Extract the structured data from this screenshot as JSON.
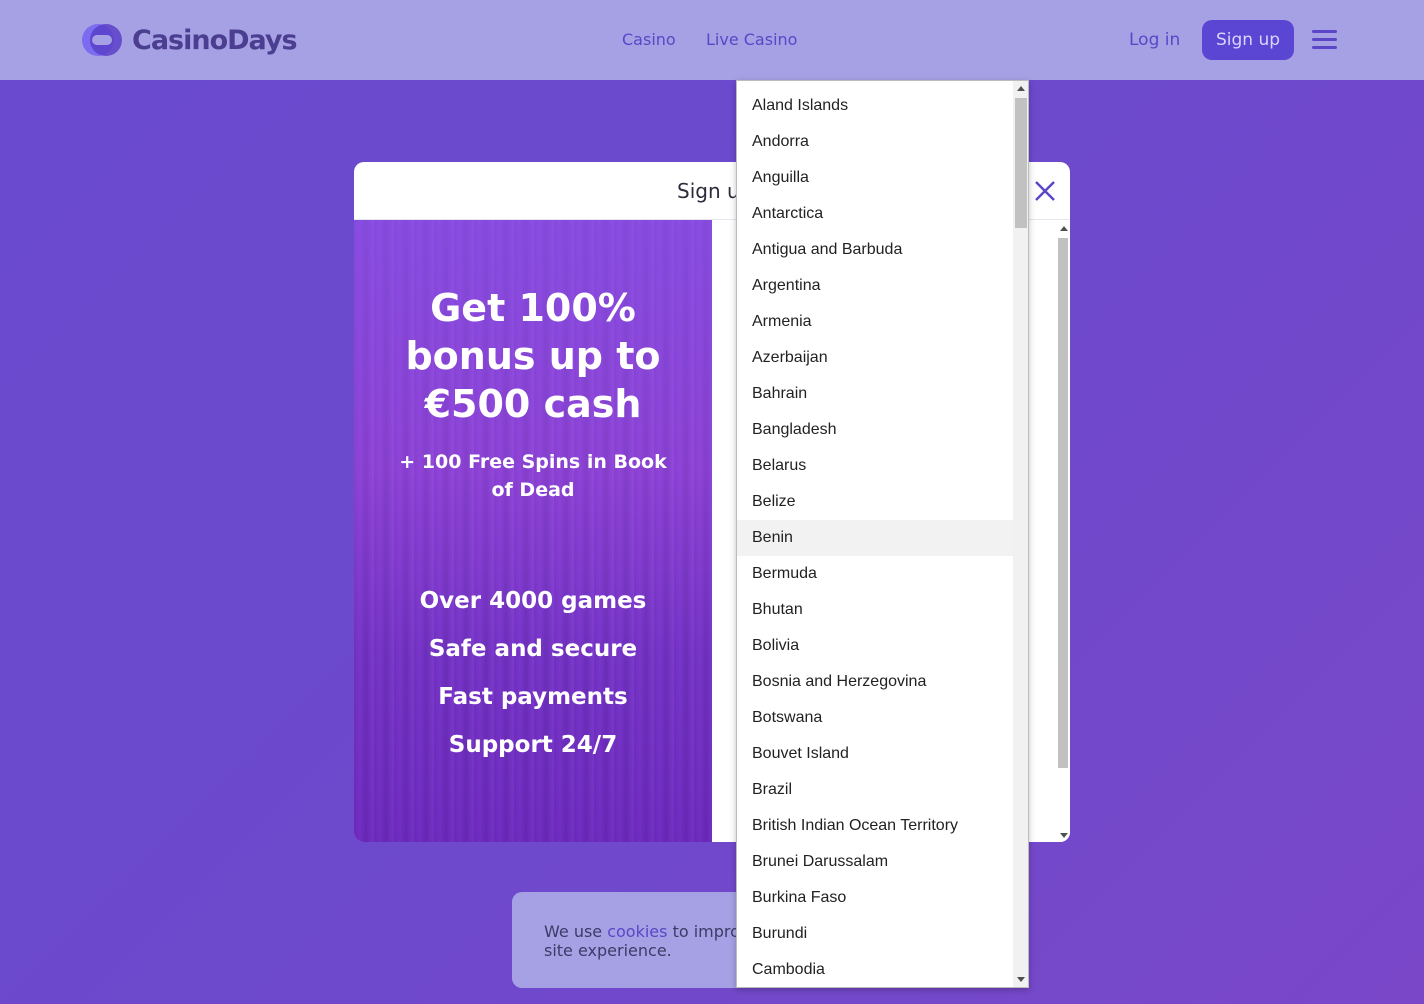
{
  "header": {
    "logo_text": "CasinoDays",
    "nav": [
      {
        "label": "Casino"
      },
      {
        "label": "Live Casino"
      }
    ],
    "login_label": "Log in",
    "signup_label": "Sign up"
  },
  "modal": {
    "title": "Sign u",
    "promo": {
      "headline": "Get 100% bonus up to €500 cash",
      "subline": "+ 100 Free Spins in Book of Dead",
      "features": [
        "Over 4000 games",
        "Safe and secure",
        "Fast payments",
        "Support 24/7"
      ]
    }
  },
  "cookie": {
    "prefix": "We use ",
    "link": "cookies",
    "suffix": " to improv",
    "line2": "site experience."
  },
  "country_dropdown": {
    "hovered": "Benin",
    "options": [
      "Aland Islands",
      "Andorra",
      "Anguilla",
      "Antarctica",
      "Antigua and Barbuda",
      "Argentina",
      "Armenia",
      "Azerbaijan",
      "Bahrain",
      "Bangladesh",
      "Belarus",
      "Belize",
      "Benin",
      "Bermuda",
      "Bhutan",
      "Bolivia",
      "Bosnia and Herzegovina",
      "Botswana",
      "Bouvet Island",
      "Brazil",
      "British Indian Ocean Territory",
      "Brunei Darussalam",
      "Burkina Faso",
      "Burundi",
      "Cambodia"
    ]
  },
  "colors": {
    "header_bg": "#a6a1e4",
    "brand": "#5b46d4",
    "page_bg": "#6d49cc"
  }
}
